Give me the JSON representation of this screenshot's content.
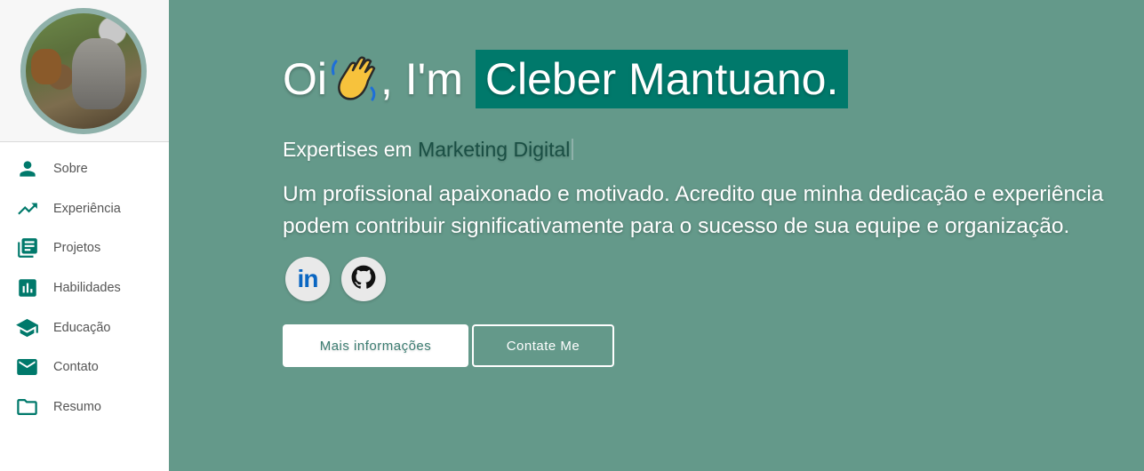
{
  "sidebar": {
    "avatar_alt": "Profile photo",
    "items": [
      {
        "label": "Sobre",
        "icon": "person-icon"
      },
      {
        "label": "Experiência",
        "icon": "trending-up-icon"
      },
      {
        "label": "Projetos",
        "icon": "library-books-icon"
      },
      {
        "label": "Habilidades",
        "icon": "bar-chart-icon"
      },
      {
        "label": "Educação",
        "icon": "school-icon"
      },
      {
        "label": "Contato",
        "icon": "mail-icon"
      },
      {
        "label": "Resumo",
        "icon": "folder-icon"
      }
    ]
  },
  "hero": {
    "greeting_prefix": "Oi",
    "greeting_mid": ", I'm",
    "name": "Cleber Mantuano.",
    "subtitle_prefix": "Expertises em",
    "subtitle_accent": "Marketing Digital",
    "description": "Um profissional apaixonado e motivado. Acredito que minha dedicação e experiência podem contribuir significativamente para o sucesso de sua equipe e organização.",
    "socials": [
      {
        "label": "in",
        "icon": "linkedin-icon"
      },
      {
        "label": "",
        "icon": "github-icon"
      }
    ],
    "primary_button": "Mais informações",
    "secondary_button": "Contate Me"
  },
  "colors": {
    "background": "#64998a",
    "accent": "#00796b",
    "sidebar_icon": "#00796b",
    "linkedin": "#0a66c2"
  }
}
